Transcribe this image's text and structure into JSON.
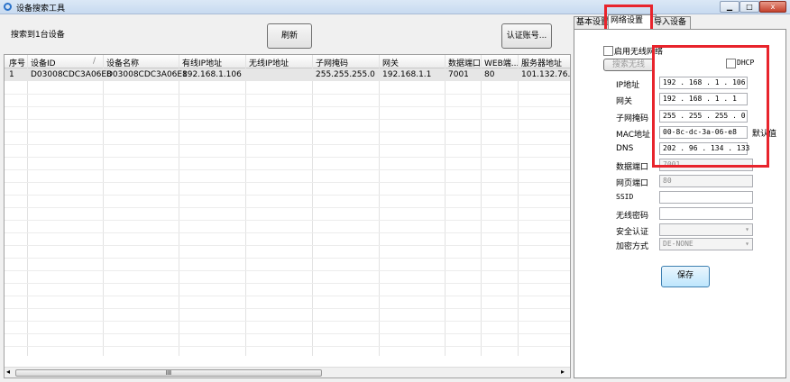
{
  "window": {
    "title": "设备搜索工具",
    "minimize_icon": "minimize-icon",
    "maximize_icon": "maximize-icon",
    "close_icon": "close-icon",
    "close_label": "x"
  },
  "toolbar": {
    "search_result": "搜索到1台设备",
    "refresh_label": "刷新",
    "auth_label": "认证账号..."
  },
  "table": {
    "columns": [
      "序号",
      "设备ID",
      "设备名称",
      "有线IP地址",
      "无线IP地址",
      "子网掩码",
      "网关",
      "数据端口",
      "WEB端...",
      "服务器地址"
    ],
    "rows": [
      [
        "1",
        "D03008CDC3A06E8",
        "D03008CDC3A06E8",
        "192.168.1.106",
        "",
        "255.255.255.0",
        "192.168.1.1",
        "7001",
        "80",
        "101.132.76.44"
      ]
    ],
    "sort_indicator": "/",
    "scroll_thumb_label": "III",
    "scroll_left": "◂",
    "scroll_right": "▸"
  },
  "tabs": [
    {
      "label": "基本设置"
    },
    {
      "label": "网络设置"
    },
    {
      "label": "导入设备"
    }
  ],
  "network": {
    "wireless_enable_label": "启用无线网络",
    "search_wireless_label": "搜索无线",
    "dhcp_label": "DHCP",
    "ip_label": "IP地址",
    "ip_value": "192 . 168 .  1  . 106",
    "gateway_label": "网关",
    "gateway_value": "192 . 168 .  1  .  1",
    "mask_label": "子网掩码",
    "mask_value": "255 . 255 . 255 .  0",
    "mac_label": "MAC地址",
    "mac_value": "00-8c-dc-3a-06-e8",
    "default_label": "默认值",
    "dns_label": "DNS",
    "dns_value": "202 .  96 . 134 . 133",
    "data_port_label": "数据端口",
    "data_port_value": "7001",
    "web_port_label": "网页端口",
    "web_port_value": "80",
    "ssid_label": "SSID",
    "ssid_value": "",
    "wifi_password_label": "无线密码",
    "wifi_password_value": "",
    "security_label": "安全认证",
    "security_value": "",
    "encryption_label": "加密方式",
    "encryption_value": "DE-NONE",
    "save_label": "保存"
  },
  "colors": {
    "highlight": "#e8242c",
    "accent": "#3c7fb1"
  }
}
